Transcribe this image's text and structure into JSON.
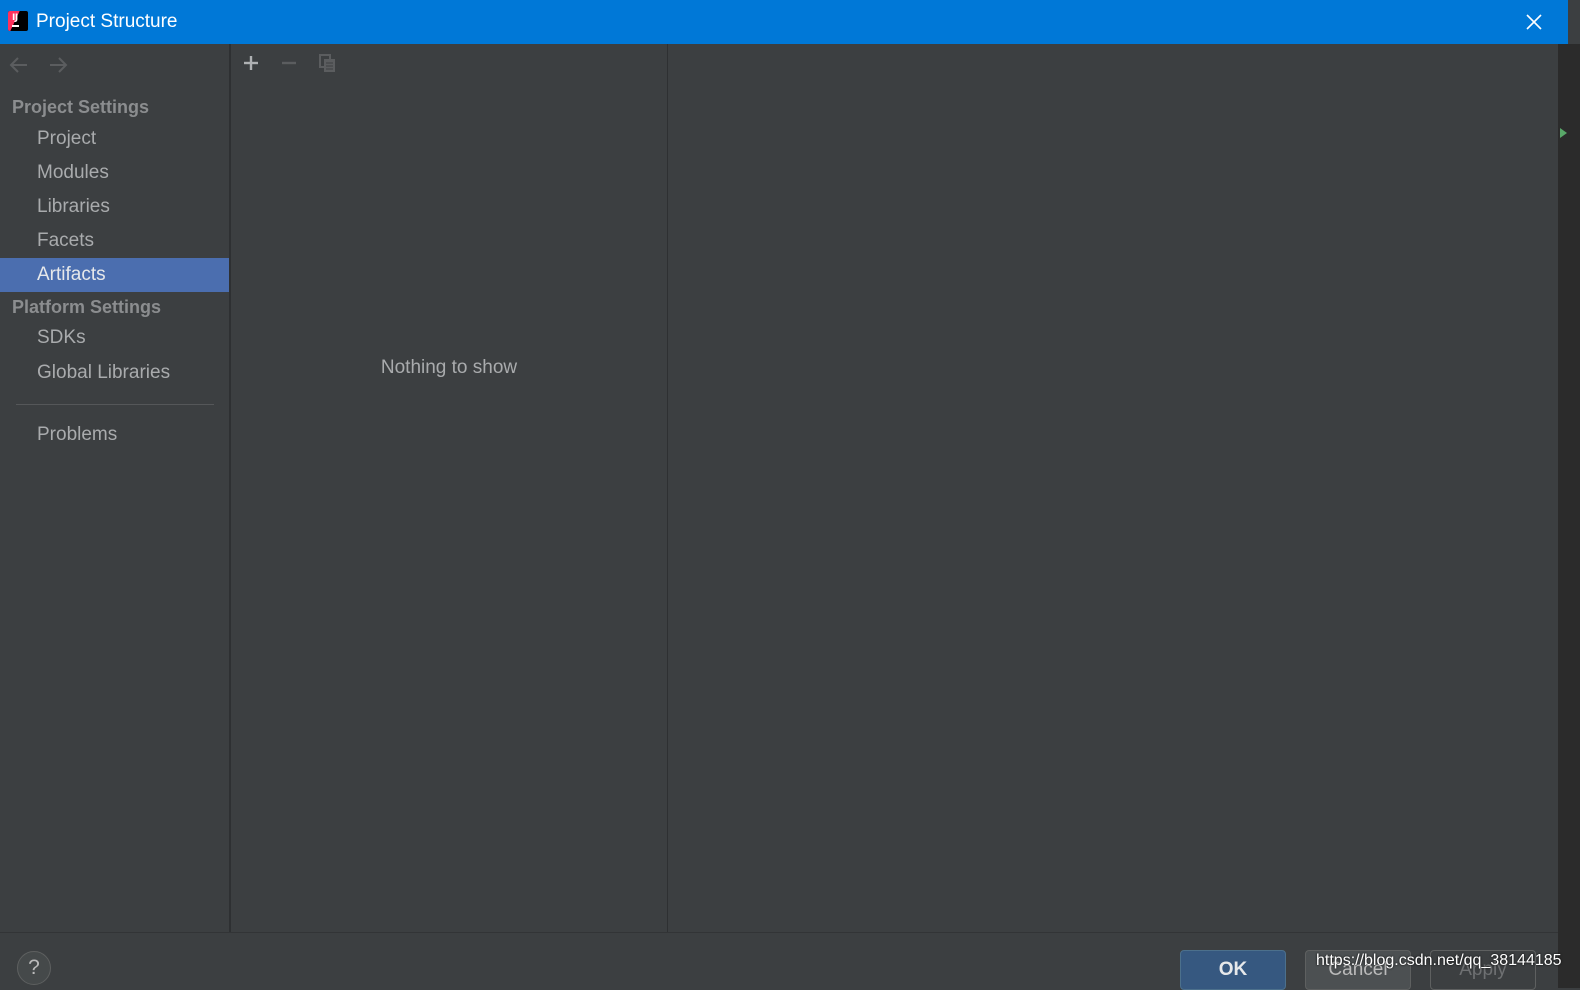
{
  "window": {
    "title": "Project Structure"
  },
  "icons": {
    "app": "intellij-icon",
    "close": "close-icon",
    "back": "back-arrow-icon",
    "forward": "forward-arrow-icon",
    "add": "plus-icon",
    "remove": "minus-icon",
    "copy": "copy-icon"
  },
  "sidebar": {
    "project_settings": {
      "header": "Project Settings",
      "items": [
        {
          "label": "Project"
        },
        {
          "label": "Modules"
        },
        {
          "label": "Libraries"
        },
        {
          "label": "Facets"
        },
        {
          "label": "Artifacts",
          "selected": true
        }
      ]
    },
    "platform_settings": {
      "header": "Platform Settings",
      "items": [
        {
          "label": "SDKs"
        },
        {
          "label": "Global Libraries"
        }
      ]
    },
    "problems": {
      "label": "Problems"
    }
  },
  "list": {
    "empty_text": "Nothing to show"
  },
  "footer": {
    "help": "?",
    "ok": "OK",
    "cancel": "Cancel",
    "apply": "Apply"
  },
  "watermark": "https://blog.csdn.net/qq_38144185",
  "colors": {
    "titlebar": "#0078d7",
    "background": "#3c3f41",
    "selection": "#4b6eaf",
    "ok_button": "#365880"
  }
}
